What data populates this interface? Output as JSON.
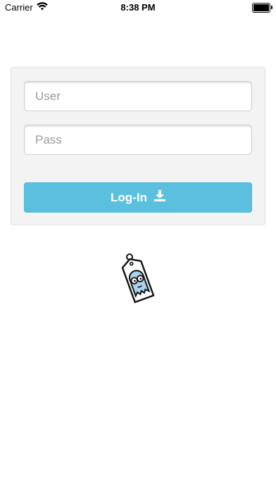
{
  "status_bar": {
    "carrier": "Carrier",
    "time": "8:38 PM",
    "wifi_icon": "wifi-icon",
    "battery_icon": "battery-icon",
    "battery_level": 1.0
  },
  "login_form": {
    "user_placeholder": "User",
    "user_value": "",
    "pass_placeholder": "Pass",
    "pass_value": "",
    "button_label": "Log-In",
    "button_icon": "download-icon"
  },
  "mascot": {
    "icon": "ghost-tag-logo"
  },
  "colors": {
    "panel_background": "#f3f3f3",
    "button_background": "#5bc0de",
    "button_text": "#ffffff",
    "mascot_fill": "#a8d4ee"
  }
}
